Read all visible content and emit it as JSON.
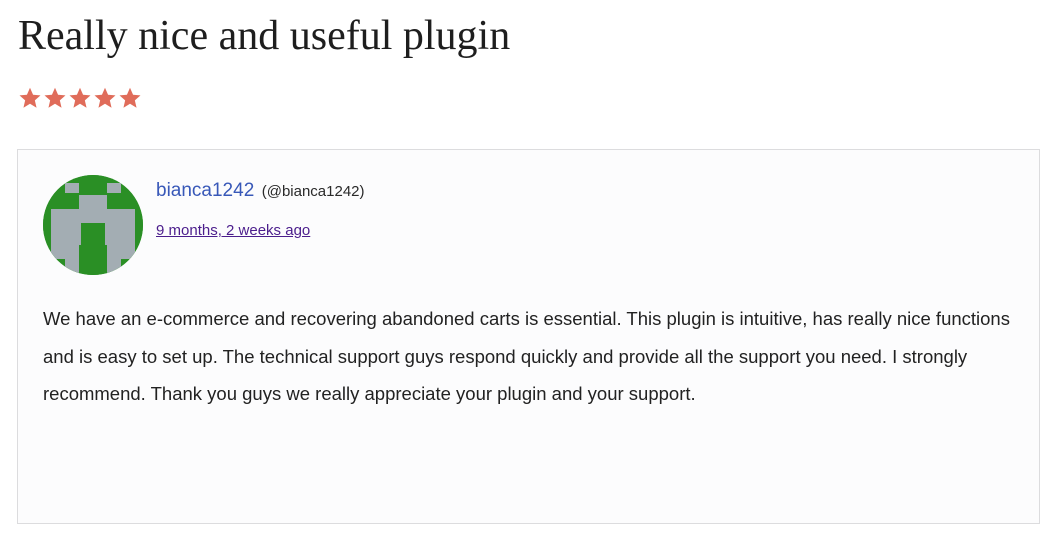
{
  "review": {
    "title": "Really nice and useful plugin",
    "rating": 5,
    "rating_max": 5,
    "star_color": "#e06c5a",
    "author": {
      "name": "bianca1242",
      "handle": "(@bianca1242)",
      "avatar_icon": "identicon-avatar",
      "avatar_colors": [
        "#2a8f25",
        "#a3adb3"
      ]
    },
    "date": "9 months, 2 weeks ago",
    "body": "We have an e-commerce and recovering abandoned carts is essential. This plugin is intuitive, has really nice functions and is easy to set up. The technical support guys respond quickly and provide all the support you need. I strongly recommend. Thank you guys we really appreciate your plugin and your support."
  }
}
